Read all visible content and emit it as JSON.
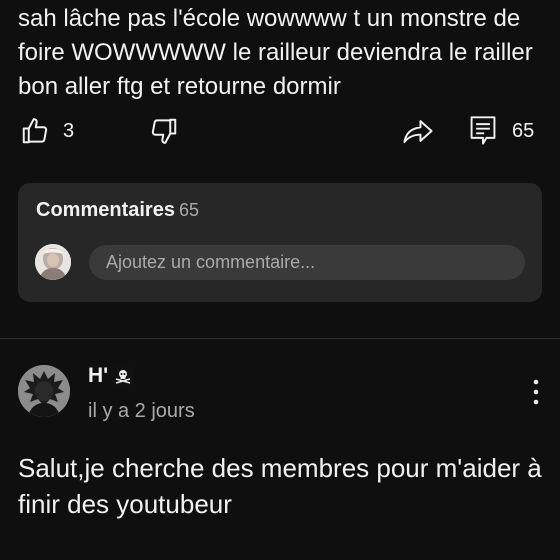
{
  "post": {
    "text": "sah lâche pas l'école wowwww t un monstre de foire WOWWWWW le railleur deviendra le railler bon aller ftg et retourne dormir",
    "like_count": "3",
    "comment_count": "65"
  },
  "comments_section": {
    "title": "Commentaires",
    "count": "65",
    "input_placeholder": "Ajoutez un commentaire..."
  },
  "comment": {
    "author": "H'",
    "author_badge": "skull-flag-icon",
    "timestamp": "il y a 2 jours",
    "text": "Salut,je cherche des membres pour m'aider à finir des youtubeur"
  },
  "colors": {
    "background": "#0f0f0f",
    "card": "#272727",
    "input": "#3a3a3a",
    "text": "#f1f1f1",
    "muted": "#aaaaaa"
  }
}
